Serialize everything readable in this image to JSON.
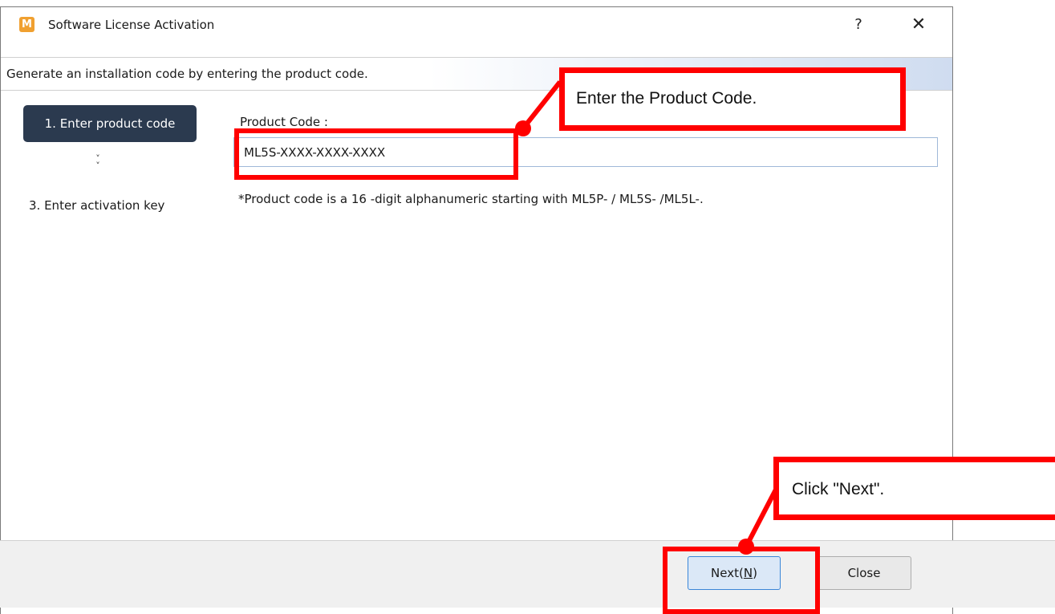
{
  "window": {
    "icon_letter": "M",
    "title": "Software License Activation",
    "help_label": "?",
    "close_label": "✕"
  },
  "header": {
    "text": "Generate an installation code by entering the product code."
  },
  "steps": {
    "step1": "1. Enter product code",
    "chevron": "˅\n˅",
    "step3": "3. Enter activation key"
  },
  "form": {
    "product_code_label": "Product Code :",
    "product_code_value": "ML5S-XXXX-XXXX-XXXX",
    "hint": "*Product code is a 16 -digit alphanumeric starting with ML5P- / ML5S- /ML5L-."
  },
  "footer": {
    "next_label_pre": "Next(",
    "next_label_key": "N",
    "next_label_post": ")",
    "close_label": "Close"
  },
  "annotations": {
    "callout_product": "Enter the Product Code.",
    "callout_next": "Click \"Next\".",
    "color": "#ff0000"
  }
}
